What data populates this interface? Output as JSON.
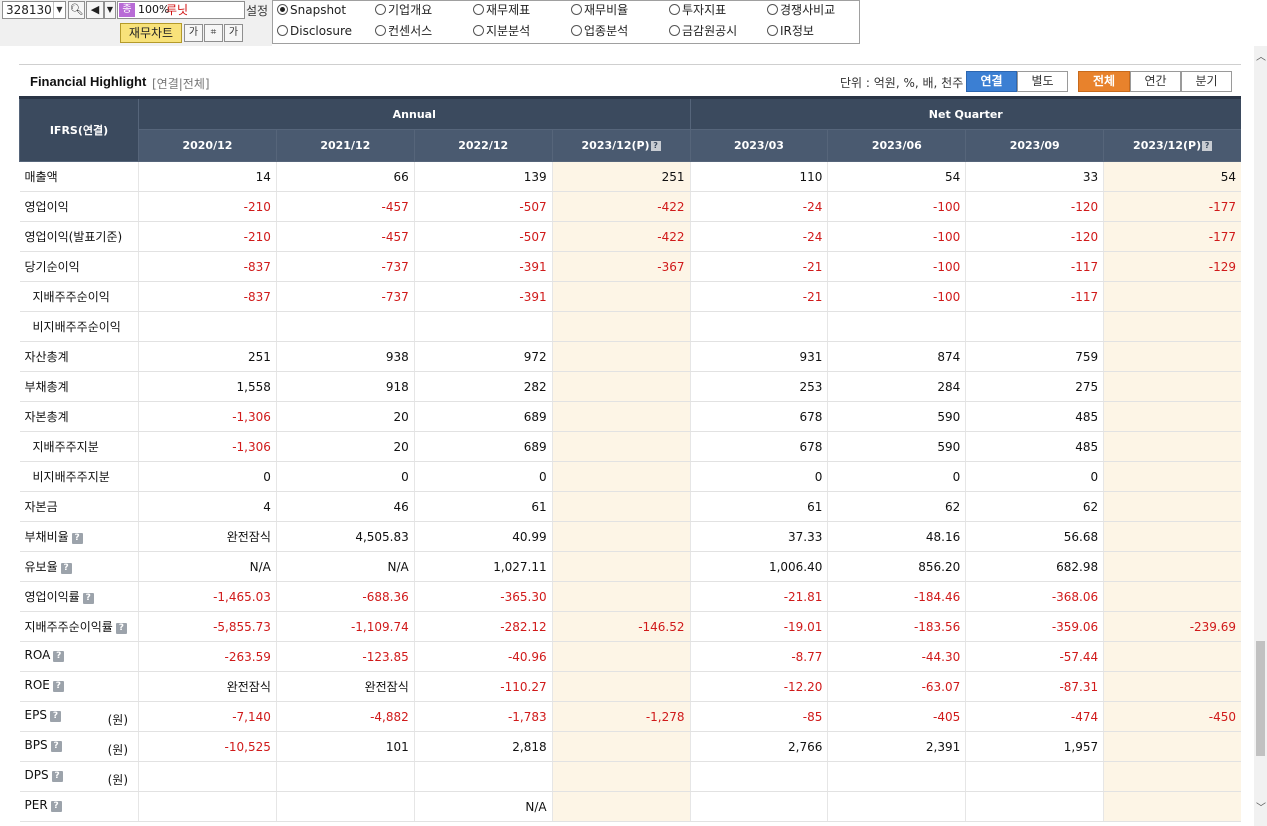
{
  "toolbar": {
    "stock_code": "328130",
    "zoom": "100%",
    "company_name": "루닛",
    "zoom_icon": "종",
    "settings_label": "설정",
    "chart_button": "재무차트",
    "icons": [
      "search-icon",
      "speaker-icon",
      "dropdown-icon",
      "font-size-icon",
      "capture-icon",
      "text-icon"
    ]
  },
  "radios": [
    {
      "label": "Snapshot",
      "selected": true
    },
    {
      "label": "기업개요",
      "selected": false
    },
    {
      "label": "재무제표",
      "selected": false
    },
    {
      "label": "재무비율",
      "selected": false
    },
    {
      "label": "투자지표",
      "selected": false
    },
    {
      "label": "경쟁사비교",
      "selected": false
    },
    {
      "label": "Disclosure",
      "selected": false
    },
    {
      "label": "컨센서스",
      "selected": false
    },
    {
      "label": "지분분석",
      "selected": false
    },
    {
      "label": "업종분석",
      "selected": false
    },
    {
      "label": "금감원공시",
      "selected": false
    },
    {
      "label": "IR정보",
      "selected": false
    }
  ],
  "section": {
    "title": "Financial Highlight",
    "subtitle": "[연결|전체]",
    "unit_label": "단위 : 억원, %, 배, 천주",
    "consolidation_toggle": [
      "연결",
      "별도"
    ],
    "period_toggle": [
      "전체",
      "연간",
      "분기"
    ],
    "active_consolidation": "연결",
    "active_period": "전체"
  },
  "table": {
    "corner_label": "IFRS(연결)",
    "group_annual": "Annual",
    "group_quarter": "Net Quarter",
    "columns": [
      "2020/12",
      "2021/12",
      "2022/12",
      "2023/12(P)",
      "2023/03",
      "2023/06",
      "2023/09",
      "2023/12(P)"
    ],
    "estimate_columns": [
      3,
      7
    ],
    "rows": [
      {
        "label": "매출액",
        "values": [
          "14",
          "66",
          "139",
          "251",
          "110",
          "54",
          "33",
          "54"
        ]
      },
      {
        "label": "영업이익",
        "values": [
          "-210",
          "-457",
          "-507",
          "-422",
          "-24",
          "-100",
          "-120",
          "-177"
        ]
      },
      {
        "label": "영업이익(발표기준)",
        "values": [
          "-210",
          "-457",
          "-507",
          "-422",
          "-24",
          "-100",
          "-120",
          "-177"
        ]
      },
      {
        "label": "당기순이익",
        "values": [
          "-837",
          "-737",
          "-391",
          "-367",
          "-21",
          "-100",
          "-117",
          "-129"
        ]
      },
      {
        "label": "지배주주순이익",
        "indent": true,
        "values": [
          "-837",
          "-737",
          "-391",
          "",
          "-21",
          "-100",
          "-117",
          ""
        ]
      },
      {
        "label": "비지배주주순이익",
        "indent": true,
        "values": [
          "",
          "",
          "",
          "",
          "",
          "",
          "",
          ""
        ]
      },
      {
        "label": "자산총계",
        "values": [
          "251",
          "938",
          "972",
          "",
          "931",
          "874",
          "759",
          ""
        ]
      },
      {
        "label": "부채총계",
        "values": [
          "1,558",
          "918",
          "282",
          "",
          "253",
          "284",
          "275",
          ""
        ]
      },
      {
        "label": "자본총계",
        "values": [
          "-1,306",
          "20",
          "689",
          "",
          "678",
          "590",
          "485",
          ""
        ]
      },
      {
        "label": "지배주주지분",
        "indent": true,
        "values": [
          "-1,306",
          "20",
          "689",
          "",
          "678",
          "590",
          "485",
          ""
        ]
      },
      {
        "label": "비지배주주지분",
        "indent": true,
        "values": [
          "0",
          "0",
          "0",
          "",
          "0",
          "0",
          "0",
          ""
        ]
      },
      {
        "label": "자본금",
        "values": [
          "4",
          "46",
          "61",
          "",
          "61",
          "62",
          "62",
          ""
        ]
      },
      {
        "label": "부채비율",
        "help": true,
        "values": [
          "완전잠식",
          "4,505.83",
          "40.99",
          "",
          "37.33",
          "48.16",
          "56.68",
          ""
        ]
      },
      {
        "label": "유보율",
        "help": true,
        "values": [
          "N/A",
          "N/A",
          "1,027.11",
          "",
          "1,006.40",
          "856.20",
          "682.98",
          ""
        ]
      },
      {
        "label": "영업이익률",
        "help": true,
        "values": [
          "-1,465.03",
          "-688.36",
          "-365.30",
          "",
          "-21.81",
          "-184.46",
          "-368.06",
          ""
        ]
      },
      {
        "label": "지배주주순이익률",
        "help": true,
        "values": [
          "-5,855.73",
          "-1,109.74",
          "-282.12",
          "-146.52",
          "-19.01",
          "-183.56",
          "-359.06",
          "-239.69"
        ]
      },
      {
        "label": "ROA",
        "help": true,
        "values": [
          "-263.59",
          "-123.85",
          "-40.96",
          "",
          "-8.77",
          "-44.30",
          "-57.44",
          ""
        ]
      },
      {
        "label": "ROE",
        "help": true,
        "values": [
          "완전잠식",
          "완전잠식",
          "-110.27",
          "",
          "-12.20",
          "-63.07",
          "-87.31",
          ""
        ]
      },
      {
        "label": "EPS",
        "help": true,
        "unit": "(원)",
        "values": [
          "-7,140",
          "-4,882",
          "-1,783",
          "-1,278",
          "-85",
          "-405",
          "-474",
          "-450"
        ]
      },
      {
        "label": "BPS",
        "help": true,
        "unit": "(원)",
        "values": [
          "-10,525",
          "101",
          "2,818",
          "",
          "2,766",
          "2,391",
          "1,957",
          ""
        ]
      },
      {
        "label": "DPS",
        "help": true,
        "unit": "(원)",
        "values": [
          "",
          "",
          "",
          "",
          "",
          "",
          "",
          ""
        ]
      },
      {
        "label": "PER",
        "help": true,
        "values": [
          "",
          "",
          "N/A",
          "",
          "",
          "",
          "",
          ""
        ]
      }
    ]
  },
  "colors": {
    "header_bg": "#3b4a5e",
    "estimate_bg": "#fdf5e6",
    "negative": "#d01a1a",
    "toggle_blue": "#3b7fd3",
    "toggle_orange": "#e8822c"
  }
}
